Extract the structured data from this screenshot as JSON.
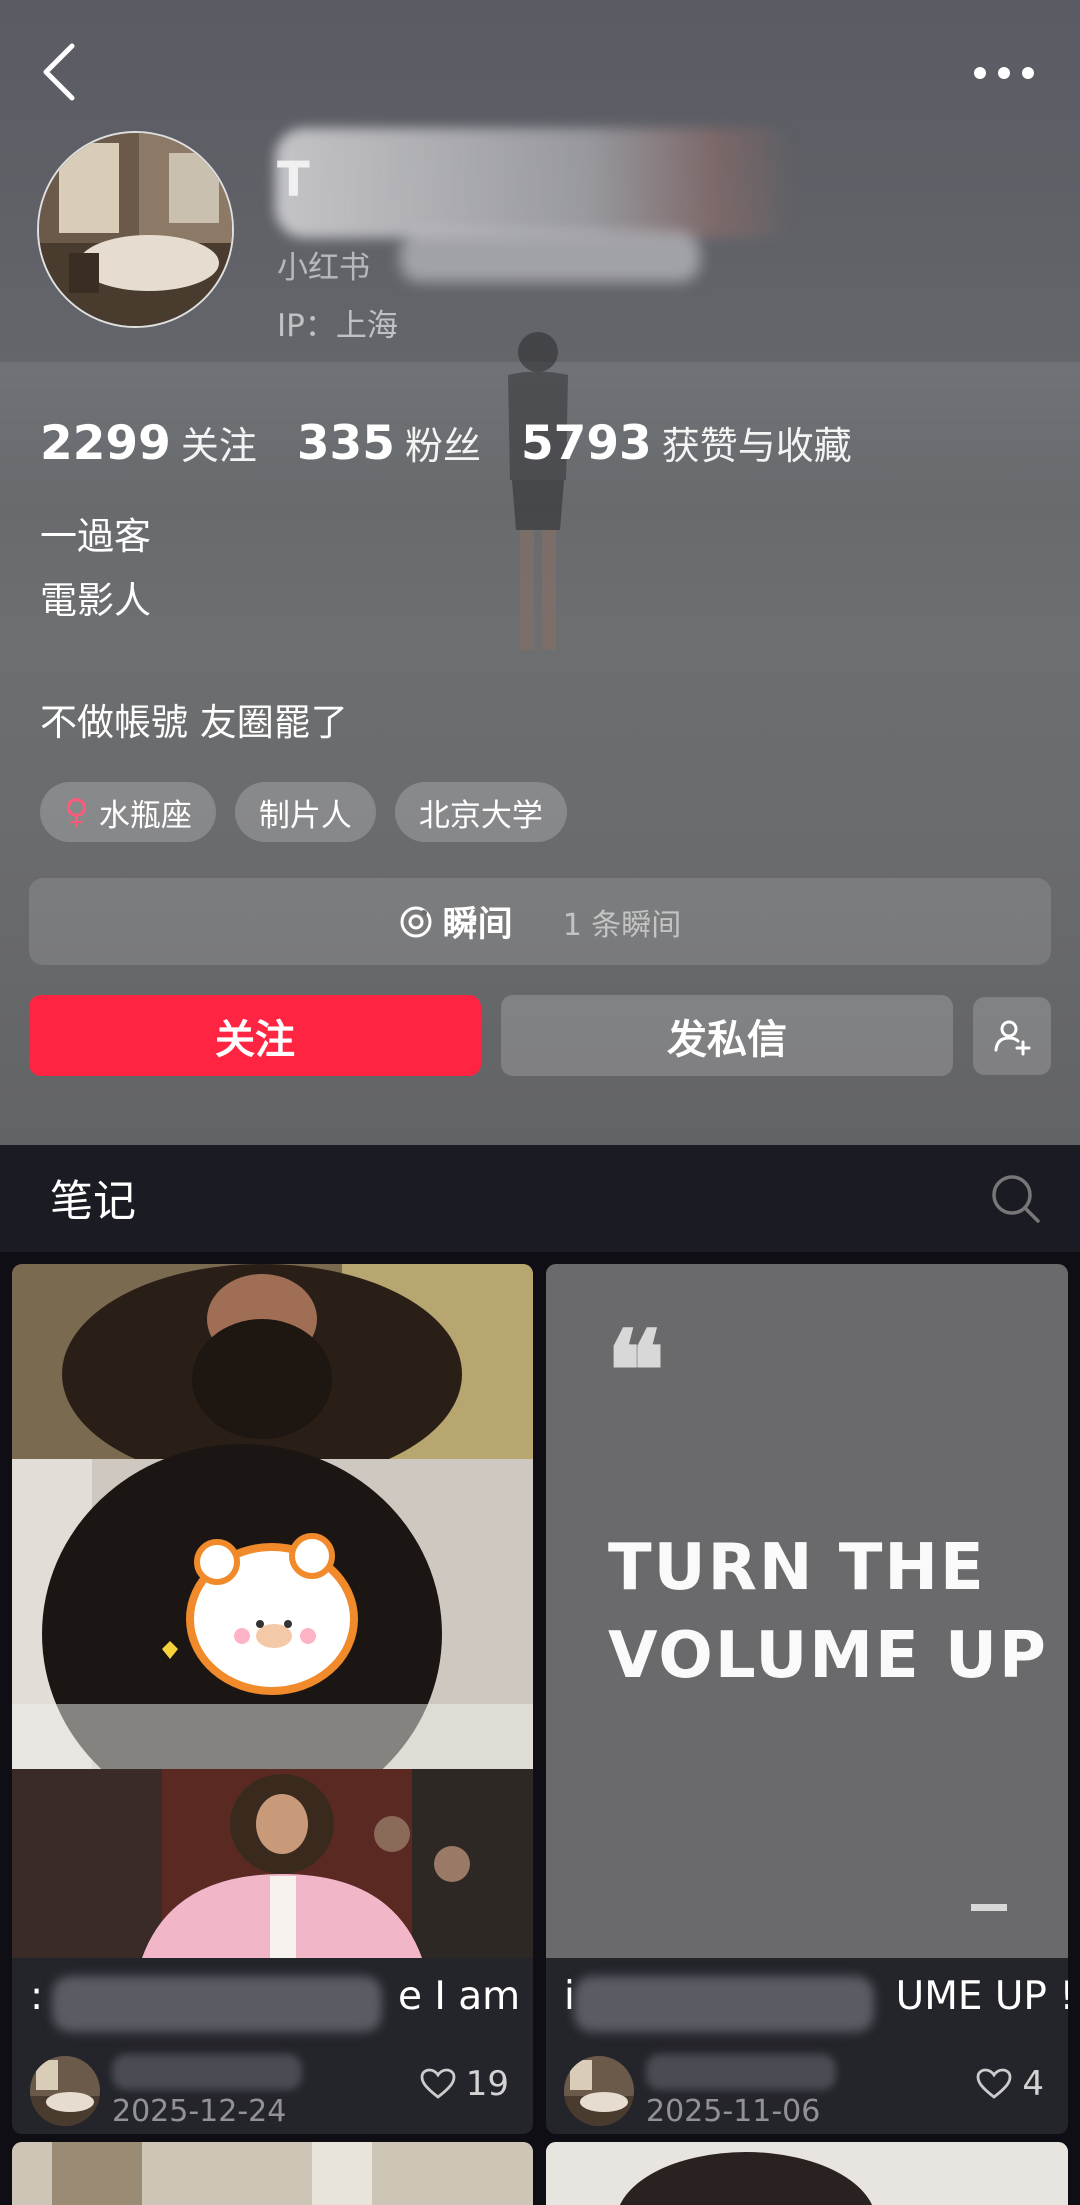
{
  "profile": {
    "name": "T",
    "platform_label": "小红书",
    "ip_label": "IP：上海",
    "stats": [
      {
        "value": "2299",
        "label": "关注"
      },
      {
        "value": "335",
        "label": "粉丝"
      },
      {
        "value": "5793",
        "label": "获赞与收藏"
      }
    ],
    "bio_lines": [
      "一過客",
      "電影人"
    ],
    "bio_extra": "不做帳號 友圈罷了",
    "tags": [
      "水瓶座",
      "制片人",
      "北京大学"
    ],
    "gender_symbol": "♀",
    "moment": {
      "title": "瞬间",
      "count": "1 条瞬间"
    },
    "follow_label": "关注",
    "message_label": "发私信"
  },
  "colors": {
    "accent": "#ff2442",
    "female": "#ff5a78",
    "feed_bg": "#0e0e14",
    "card_bg": "#24242b"
  },
  "notes": {
    "tab_label": "笔记"
  },
  "feed": [
    {
      "title_visible": "e I am",
      "title_prefix": ":",
      "date": "2025-12-24",
      "likes": "19"
    },
    {
      "quote_mark": "❝",
      "quote_text_line1": "TURN THE",
      "quote_text_line2": "VOLUME UP",
      "title_visible": "UME UP !",
      "title_prefix": "i",
      "date": "2025-11-06",
      "likes": "4"
    }
  ]
}
